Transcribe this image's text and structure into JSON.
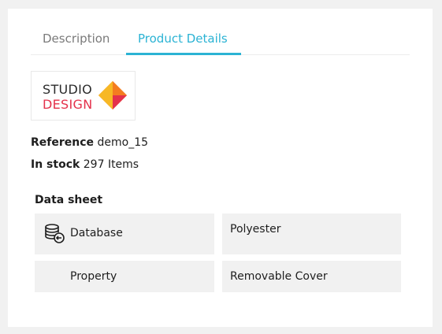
{
  "tabs": {
    "description": "Description",
    "product_details": "Product Details",
    "active": "product_details",
    "active_color": "#2bb3d4"
  },
  "brand": {
    "line1": "STUDIO",
    "line2": "DESIGN",
    "line1_color": "#2b2b2b",
    "line2_color": "#e4314b",
    "mark_colors": [
      "#f7b825",
      "#f47c20",
      "#e4314b"
    ]
  },
  "product": {
    "reference_label": "Reference",
    "reference_value": "demo_15",
    "stock_label": "In stock",
    "stock_value": "297 Items"
  },
  "data_sheet": {
    "title": "Data sheet",
    "rows": [
      {
        "name": "Database",
        "value": "Polyester",
        "icon": "database-icon"
      },
      {
        "name": "Property",
        "value": "Removable Cover"
      }
    ]
  }
}
